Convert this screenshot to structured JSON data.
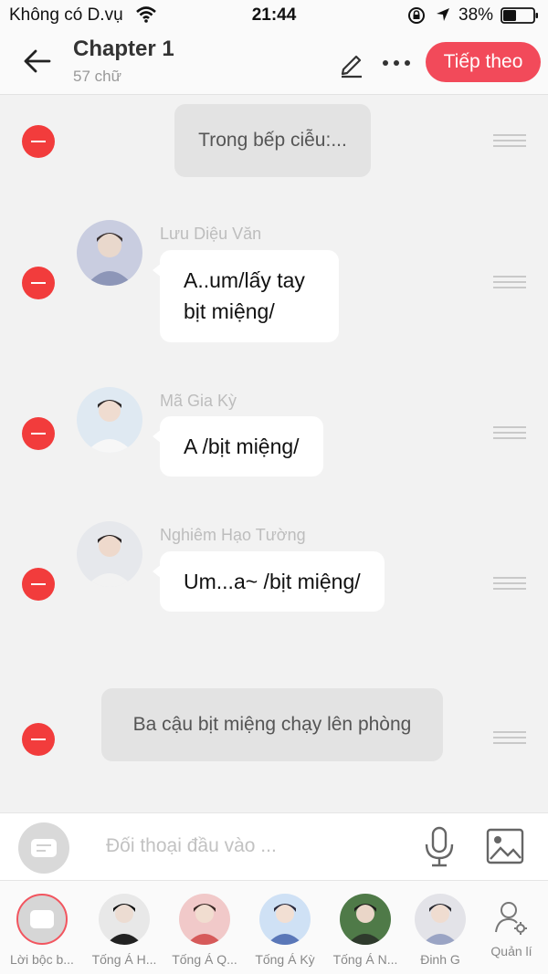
{
  "status_bar": {
    "carrier": "Không có D.vụ",
    "time": "21:44",
    "battery": "38%"
  },
  "header": {
    "title": "Chapter 1",
    "subtitle": "57 chữ",
    "next_label": "Tiếp theo"
  },
  "messages": [
    {
      "type": "narration",
      "text": "Trong bếp ciễu:..."
    },
    {
      "type": "dialogue",
      "name": "Lưu Diệu Văn",
      "line1": "A..um/lấy tay",
      "line2": "bịt miệng/"
    },
    {
      "type": "dialogue",
      "name": "Mã Gia Kỳ",
      "text": "A /bịt miệng/"
    },
    {
      "type": "dialogue",
      "name": "Nghiêm Hạo Tường",
      "text": "Um...a~ /bịt miệng/"
    },
    {
      "type": "narration",
      "text": "Ba cậu bịt miệng chạy lên phòng"
    }
  ],
  "input": {
    "placeholder": "Đối thoại đầu vào ..."
  },
  "characters": [
    {
      "label": "Lời bộc b...",
      "icon": "narration-icon",
      "selected": true
    },
    {
      "label": "Tống Á H..."
    },
    {
      "label": "Tống Á Q..."
    },
    {
      "label": "Tống Á Kỳ"
    },
    {
      "label": "Tống Á N..."
    },
    {
      "label": "Đinh G"
    }
  ],
  "manage_label": "Quản lí",
  "colors": {
    "accent": "#f24a5a",
    "delete": "#f23c3c",
    "background": "#f2f2f2"
  }
}
